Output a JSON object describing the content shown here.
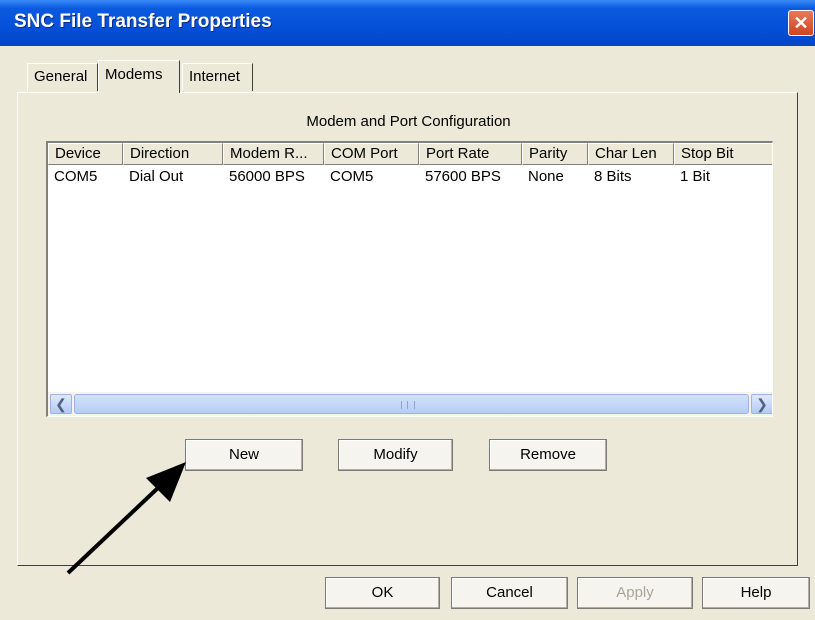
{
  "window": {
    "title": "SNC File Transfer Properties"
  },
  "tabs": [
    {
      "label": "General",
      "active": false
    },
    {
      "label": "Modems",
      "active": true
    },
    {
      "label": "Internet",
      "active": false
    }
  ],
  "panel": {
    "section_label": "Modem and Port Configuration",
    "columns": [
      "Device",
      "Direction",
      "Modem R...",
      "COM Port",
      "Port Rate",
      "Parity",
      "Char Len",
      "Stop Bit"
    ],
    "rows": [
      [
        "COM5",
        "Dial Out",
        "56000 BPS",
        "COM5",
        "57600 BPS",
        "None",
        "8 Bits",
        "1 Bit"
      ]
    ],
    "buttons": {
      "new": "New",
      "modify": "Modify",
      "remove": "Remove"
    }
  },
  "footer": {
    "ok": "OK",
    "cancel": "Cancel",
    "apply": "Apply",
    "help": "Help"
  },
  "icons": {
    "close": "close-icon",
    "scroll_left": "chevron-left-icon",
    "scroll_right": "chevron-right-icon",
    "annotation": "arrow-icon"
  },
  "colors": {
    "titlebar": "#0550d8",
    "close_button": "#d0451f",
    "window_bg": "#ece9d8",
    "scrollbar": "#b7cdf6"
  }
}
